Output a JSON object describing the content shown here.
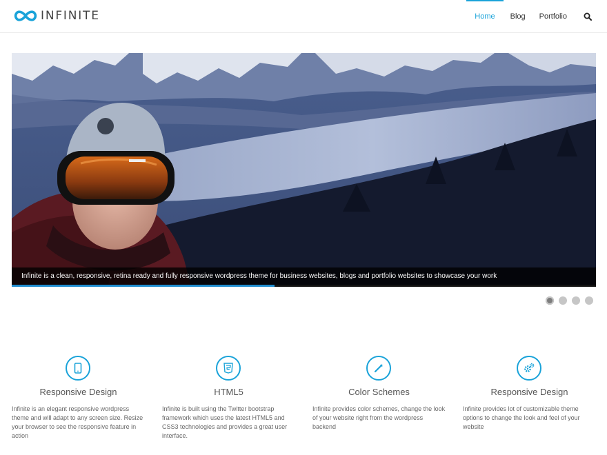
{
  "brand": {
    "name": "INFINITE",
    "accent": "#1aa3d9"
  },
  "nav": {
    "items": [
      {
        "label": "Home"
      },
      {
        "label": "Blog"
      },
      {
        "label": "Portfolio"
      }
    ],
    "search_icon": "search-icon"
  },
  "slider": {
    "caption": "Infinite is a clean, responsive, retina ready and fully responsive wordpress theme for business websites, blogs and portfolio websites to showcase your work",
    "progress": 0.45,
    "slides_count": 4,
    "active_slide": 1
  },
  "features": [
    {
      "icon": "tablet-icon",
      "title": "Responsive Design",
      "text": "Infinite is an elegant responsive wordpress theme and will adapt to any screen size. Resize your browser to see the responsive feature in action"
    },
    {
      "icon": "html5-icon",
      "title": "HTML5",
      "text": "Infinite is built using the Twitter bootstrap framework which uses the latest HTML5 and CSS3 technologies and provides a great user interface."
    },
    {
      "icon": "magic-wand-icon",
      "title": "Color Schemes",
      "text": "Infinite provides color schemes, change the look of your website right from the wordpress backend"
    },
    {
      "icon": "gears-icon",
      "title": "Responsive Design",
      "text": "Infinite provides lot of customizable theme options to change the look and feel of your website"
    }
  ]
}
